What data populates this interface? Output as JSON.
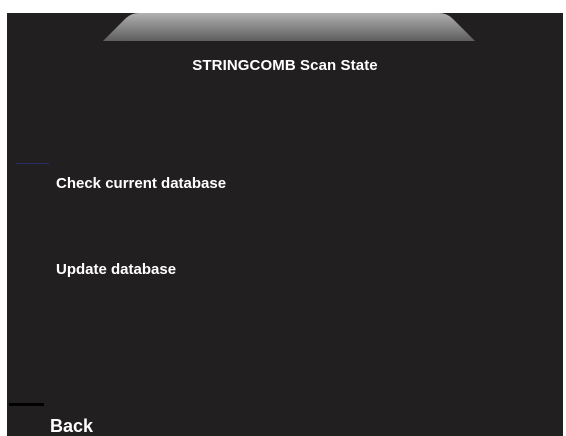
{
  "screen": {
    "title": "STRINGCOMB Scan State",
    "background_color": "#221f20",
    "tab_color": "#8d8d8d"
  },
  "menu": {
    "items": [
      {
        "label": "Check current database"
      },
      {
        "label": "Update database"
      }
    ]
  },
  "footer": {
    "back_label": "Back"
  }
}
